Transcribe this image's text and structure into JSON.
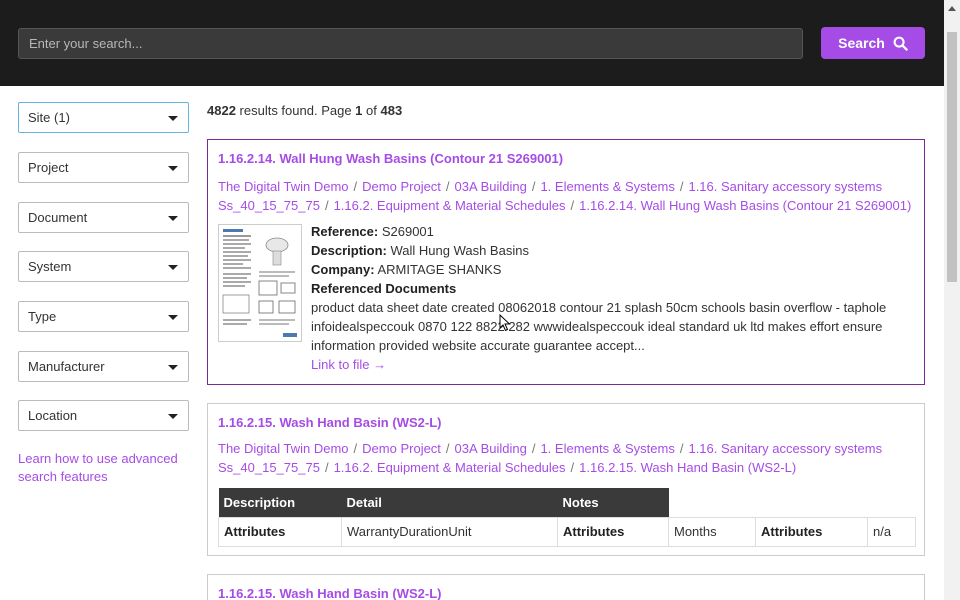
{
  "search": {
    "placeholder": "Enter your search...",
    "button_label": "Search"
  },
  "filters": [
    {
      "label": "Site (1)"
    },
    {
      "label": "Project"
    },
    {
      "label": "Document"
    },
    {
      "label": "System"
    },
    {
      "label": "Type"
    },
    {
      "label": "Manufacturer"
    },
    {
      "label": "Location"
    }
  ],
  "advanced_link": "Learn how to use advanced search features",
  "summary": {
    "count": "4822",
    "mid1": " results found. Page ",
    "page": "1",
    "mid2": " of ",
    "total_pages": "483"
  },
  "results": [
    {
      "title": "1.16.2.14. Wall Hung Wash Basins (Contour 21 S269001)",
      "crumbs": [
        "The Digital Twin Demo",
        "Demo Project",
        "03A Building",
        "1. Elements & Systems",
        "1.16. Sanitary accessory systems",
        "Ss_40_15_75_75",
        "1.16.2. Equipment & Material Schedules",
        "1.16.2.14. Wall Hung Wash Basins (Contour 21 S269001)"
      ],
      "reference_label": "Reference:",
      "reference": "S269001",
      "description_label": "Description:",
      "description": "Wall Hung Wash Basins",
      "company_label": "Company:",
      "company": "ARMITAGE SHANKS",
      "ref_docs_label": "Referenced Documents",
      "ref_docs_text": "product data sheet date created 08062018 contour 21 splash 50cm schools basin overflow - taphole infoidealspeccouk 0870 122 8822 282 wwwidealspeccouk ideal standard uk ltd makes effort ensure information provided website accurate guarantee accept...",
      "file_link": "Link to file →"
    },
    {
      "title": "1.16.2.15. Wash Hand Basin (WS2-L)",
      "crumbs": [
        "The Digital Twin Demo",
        "Demo Project",
        "03A Building",
        "1. Elements & Systems",
        "1.16. Sanitary accessory systems",
        "Ss_40_15_75_75",
        "1.16.2. Equipment & Material Schedules",
        "1.16.2.15. Wash Hand Basin (WS2-L)"
      ],
      "table_headers": [
        "Description",
        "Detail",
        "Notes"
      ],
      "table_row": [
        "Attributes",
        "WarrantyDurationUnit",
        "Attributes",
        "Months",
        "Attributes",
        "n/a"
      ]
    },
    {
      "title": "1.16.2.15. Wash Hand Basin (WS2-L)"
    }
  ]
}
